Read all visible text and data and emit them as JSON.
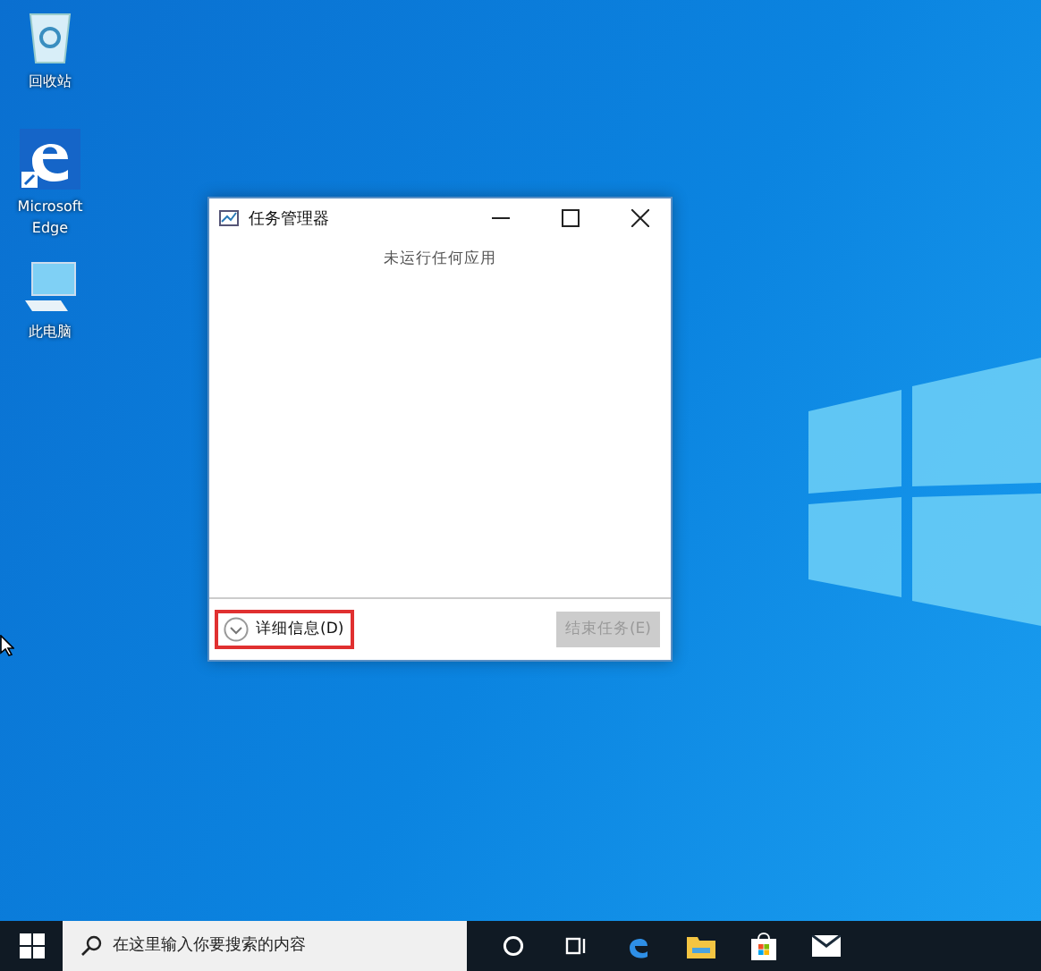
{
  "desktop_icons": [
    {
      "kind": "recycle-bin",
      "label": "回收站"
    },
    {
      "kind": "edge",
      "label": "Microsoft Edge"
    },
    {
      "kind": "computer",
      "label": "此电脑"
    }
  ],
  "window": {
    "title": "任务管理器",
    "message": "未运行任何应用",
    "details_button": {
      "label": "详细信息(D)",
      "highlighted": true
    },
    "end_task_button": {
      "label": "结束任务(E)",
      "disabled": true
    }
  },
  "taskbar": {
    "search": {
      "placeholder": "在这里输入你要搜索的内容"
    },
    "apps": [
      {
        "kind": "cortana"
      },
      {
        "kind": "task-view"
      },
      {
        "kind": "edge"
      },
      {
        "kind": "explorer"
      },
      {
        "kind": "store"
      },
      {
        "kind": "mail"
      }
    ]
  }
}
